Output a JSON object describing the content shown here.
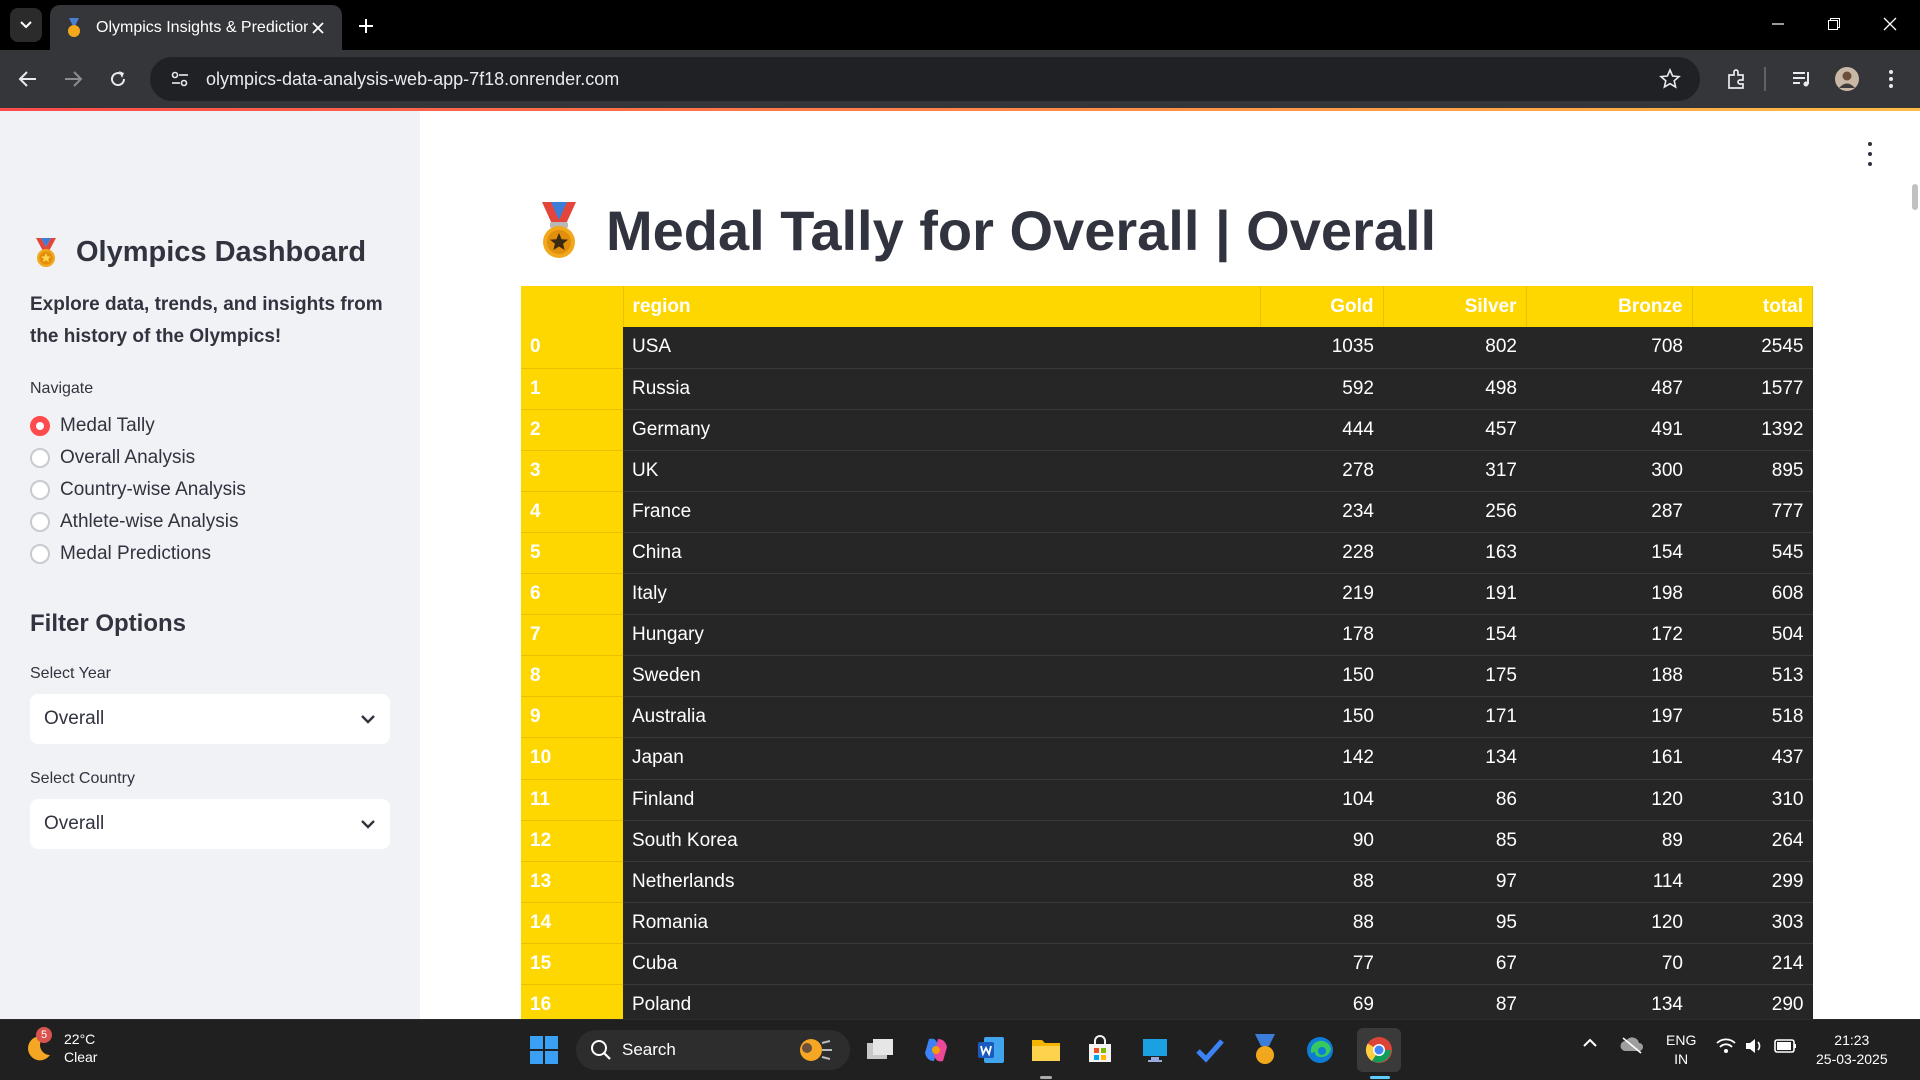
{
  "browser": {
    "tab_title": "Olympics Insights & Predictions",
    "url": "olympics-data-analysis-web-app-7f18.onrender.com"
  },
  "sidebar": {
    "title": "Olympics Dashboard",
    "description": "Explore data, trends, and insights from the history of the Olympics!",
    "navigate_label": "Navigate",
    "nav_items": [
      {
        "label": "Medal Tally",
        "selected": true
      },
      {
        "label": "Overall Analysis",
        "selected": false
      },
      {
        "label": "Country-wise Analysis",
        "selected": false
      },
      {
        "label": "Athlete-wise Analysis",
        "selected": false
      },
      {
        "label": "Medal Predictions",
        "selected": false
      }
    ],
    "filter_heading": "Filter Options",
    "year_label": "Select Year",
    "year_value": "Overall",
    "country_label": "Select Country",
    "country_value": "Overall"
  },
  "main": {
    "title": "Medal Tally for Overall | Overall",
    "table": {
      "columns": [
        "",
        "region",
        "Gold",
        "Silver",
        "Bronze",
        "total"
      ],
      "rows": [
        [
          "0",
          "USA",
          "1035",
          "802",
          "708",
          "2545"
        ],
        [
          "1",
          "Russia",
          "592",
          "498",
          "487",
          "1577"
        ],
        [
          "2",
          "Germany",
          "444",
          "457",
          "491",
          "1392"
        ],
        [
          "3",
          "UK",
          "278",
          "317",
          "300",
          "895"
        ],
        [
          "4",
          "France",
          "234",
          "256",
          "287",
          "777"
        ],
        [
          "5",
          "China",
          "228",
          "163",
          "154",
          "545"
        ],
        [
          "6",
          "Italy",
          "219",
          "191",
          "198",
          "608"
        ],
        [
          "7",
          "Hungary",
          "178",
          "154",
          "172",
          "504"
        ],
        [
          "8",
          "Sweden",
          "150",
          "175",
          "188",
          "513"
        ],
        [
          "9",
          "Australia",
          "150",
          "171",
          "197",
          "518"
        ],
        [
          "10",
          "Japan",
          "142",
          "134",
          "161",
          "437"
        ],
        [
          "11",
          "Finland",
          "104",
          "86",
          "120",
          "310"
        ],
        [
          "12",
          "South Korea",
          "90",
          "85",
          "89",
          "264"
        ],
        [
          "13",
          "Netherlands",
          "88",
          "97",
          "114",
          "299"
        ],
        [
          "14",
          "Romania",
          "88",
          "95",
          "120",
          "303"
        ],
        [
          "15",
          "Cuba",
          "77",
          "67",
          "70",
          "214"
        ],
        [
          "16",
          "Poland",
          "69",
          "87",
          "134",
          "290"
        ]
      ]
    }
  },
  "taskbar": {
    "weather_badge": "5",
    "weather_temp": "22°C",
    "weather_desc": "Clear",
    "search_label": "Search",
    "lang_top": "ENG",
    "lang_bottom": "IN",
    "time": "21:23",
    "date": "25-03-2025"
  },
  "colors": {
    "accent": "#ff4b4b",
    "table_header": "#ffd700",
    "table_body": "#262626",
    "sidebar_bg": "#f0f2f6"
  }
}
